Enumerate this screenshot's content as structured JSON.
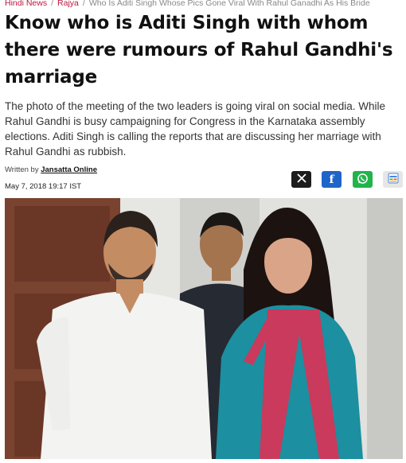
{
  "breadcrumb": {
    "items": [
      "Hindi News",
      "Rajya"
    ],
    "current": "Who Is Aditi Singh Whose Pics Gone Viral With Rahul Ganadhi As His Bride",
    "separator": "/"
  },
  "article": {
    "headline": "Know who is Aditi Singh with whom there were rumours of Rahul Gandhi's marriage",
    "summary": "The photo of the meeting of the two leaders is going viral on social media. While Rahul Gandhi is busy campaigning for Congress in the Karnataka assembly elections. Aditi Singh is calling the reports that are discussing her marriage with Rahul Gandhi as rubbish.",
    "byline_prefix": "Written by",
    "author": "Jansatta Online",
    "date": "May 7, 2018 19:17 IST"
  },
  "share": [
    {
      "icon": "x-icon",
      "glyph": "𝕏",
      "color": "#1c1c1c"
    },
    {
      "icon": "facebook-icon",
      "glyph": "f",
      "color": "#1f64c8"
    },
    {
      "icon": "whatsapp-icon",
      "glyph": "✆",
      "color": "#21b44b"
    },
    {
      "icon": "google-news-icon",
      "glyph": "",
      "color": "#e6e6e6"
    }
  ]
}
